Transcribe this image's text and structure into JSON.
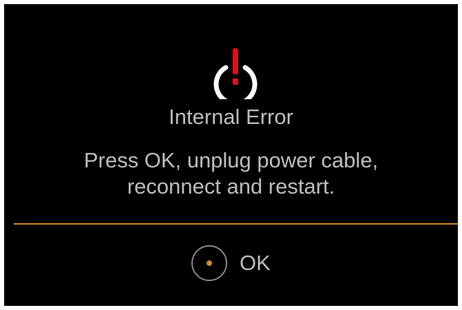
{
  "dialog": {
    "icon": "power-warning-icon",
    "title": "Internal Error",
    "message_line1": "Press OK, unplug power cable,",
    "message_line2": "reconnect and restart.",
    "ok_label": "OK"
  },
  "colors": {
    "background": "#000000",
    "text": "#bdbdbd",
    "accent": "#d08a2a",
    "warning": "#e0101a",
    "icon_ring": "#ffffff",
    "button_ring": "#8a8a8a"
  }
}
